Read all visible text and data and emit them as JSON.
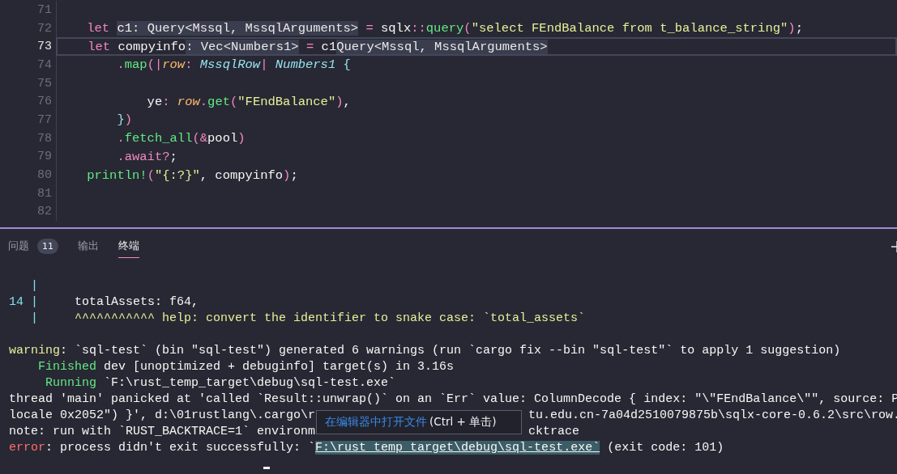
{
  "editor": {
    "lines": [
      {
        "number": "71",
        "current": false
      },
      {
        "number": "72",
        "current": false,
        "segments": [
          {
            "kind": "kw",
            "text": "    let "
          },
          {
            "kind": "sel",
            "text": "c1"
          },
          {
            "kind": "inlay",
            "text": ": Query<Mssql, MssqlArguments>"
          },
          {
            "kind": "punct",
            "text": " = "
          },
          {
            "kind": "plain",
            "text": "sqlx"
          },
          {
            "kind": "punct",
            "text": "::"
          },
          {
            "kind": "fn",
            "text": "query"
          },
          {
            "kind": "punct",
            "text": "("
          },
          {
            "kind": "str",
            "text": "\"select FEndBalance from t_balance_string\""
          },
          {
            "kind": "punct",
            "text": ")"
          },
          {
            "kind": "plain",
            "text": ";"
          }
        ]
      },
      {
        "number": "73",
        "current": true,
        "segments": [
          {
            "kind": "kw",
            "text": "    let "
          },
          {
            "kind": "plain",
            "text": "compyinfo"
          },
          {
            "kind": "inlay",
            "text": ": Vec<Numbers1>"
          },
          {
            "kind": "punct",
            "text": " = "
          },
          {
            "kind": "plain",
            "text": "c1"
          },
          {
            "kind": "inlay",
            "text": "Query<Mssql, MssqlArguments>"
          }
        ]
      },
      {
        "number": "74",
        "current": false,
        "segments": [
          {
            "kind": "punct",
            "text": "        ."
          },
          {
            "kind": "fn",
            "text": "map"
          },
          {
            "kind": "punct",
            "text": "(|"
          },
          {
            "kind": "param",
            "text": "row"
          },
          {
            "kind": "punct",
            "text": ":"
          },
          {
            "kind": "type",
            "text": " MssqlRow"
          },
          {
            "kind": "punct",
            "text": "|"
          },
          {
            "kind": "type",
            "text": " Numbers1"
          },
          {
            "kind": "brace",
            "text": " {"
          }
        ]
      },
      {
        "number": "75",
        "current": false
      },
      {
        "number": "76",
        "current": false,
        "segments": [
          {
            "kind": "plain",
            "text": "            ye"
          },
          {
            "kind": "punct",
            "text": ":"
          },
          {
            "kind": "param",
            "text": " row"
          },
          {
            "kind": "punct",
            "text": "."
          },
          {
            "kind": "fn",
            "text": "get"
          },
          {
            "kind": "punct",
            "text": "("
          },
          {
            "kind": "str",
            "text": "\"FEndBalance\""
          },
          {
            "kind": "punct",
            "text": ")"
          },
          {
            "kind": "plain",
            "text": ","
          }
        ]
      },
      {
        "number": "77",
        "current": false,
        "segments": [
          {
            "kind": "brace",
            "text": "        }"
          },
          {
            "kind": "punct",
            "text": ")"
          }
        ]
      },
      {
        "number": "78",
        "current": false,
        "segments": [
          {
            "kind": "punct",
            "text": "        ."
          },
          {
            "kind": "fn",
            "text": "fetch_all"
          },
          {
            "kind": "punct",
            "text": "(&"
          },
          {
            "kind": "plain",
            "text": "pool"
          },
          {
            "kind": "punct",
            "text": ")"
          }
        ]
      },
      {
        "number": "79",
        "current": false,
        "segments": [
          {
            "kind": "punct",
            "text": "        .await?"
          },
          {
            "kind": "plain",
            "text": ";"
          }
        ]
      },
      {
        "number": "80",
        "current": false,
        "segments": [
          {
            "kind": "fn",
            "text": "    println!"
          },
          {
            "kind": "punct",
            "text": "("
          },
          {
            "kind": "str",
            "text": "\"{:?}\""
          },
          {
            "kind": "plain",
            "text": ", compyinfo"
          },
          {
            "kind": "punct",
            "text": ")"
          },
          {
            "kind": "plain",
            "text": ";"
          }
        ]
      },
      {
        "number": "81",
        "current": false
      },
      {
        "number": "82",
        "current": false
      }
    ]
  },
  "panel": {
    "tabs": [
      {
        "label": "问题",
        "badge": "11",
        "selected": false
      },
      {
        "label": "输出",
        "selected": false
      },
      {
        "label": "终端",
        "selected": true
      }
    ],
    "terminal": {
      "lines": [
        {
          "kind": "output",
          "segments": [
            {
              "kind": "gutter",
              "text": "   |"
            }
          ]
        },
        {
          "kind": "output",
          "segments": [
            {
              "kind": "gutter",
              "text": "14 |"
            },
            {
              "kind": "plain",
              "text": "     totalAssets: f64,"
            }
          ]
        },
        {
          "kind": "output",
          "segments": [
            {
              "kind": "gutter",
              "text": "   |"
            },
            {
              "kind": "warn",
              "text": "     ^^^^^^^^^^^ help: convert the identifier to snake case: `total_assets`"
            }
          ]
        },
        {
          "kind": "blank"
        },
        {
          "kind": "output",
          "segments": [
            {
              "kind": "warn",
              "text": "warning"
            },
            {
              "kind": "plain",
              "text": ": `sql-test` (bin \"sql-test\") generated 6 warnings (run `cargo fix --bin \"sql-test\"` to apply 1 suggestion)"
            }
          ]
        },
        {
          "kind": "output",
          "segments": [
            {
              "kind": "ok",
              "text": "    Finished"
            },
            {
              "kind": "plain",
              "text": " dev [unoptimized + debuginfo] target(s) in 3.16s"
            }
          ]
        },
        {
          "kind": "output",
          "segments": [
            {
              "kind": "ok",
              "text": "     Running"
            },
            {
              "kind": "plain",
              "text": " `F:\\rust_temp_target\\debug\\sql-test.exe`"
            }
          ]
        },
        {
          "kind": "output",
          "segments": [
            {
              "kind": "plain",
              "text": "thread 'main' panicked at 'called `Result::unwrap()` on an `Err` value: ColumnDecode { index: \"\\\"FEndBalance\\\"\", source: P"
            }
          ]
        },
        {
          "kind": "output",
          "segments": [
            {
              "kind": "plain",
              "text": "locale 0x2052\") }', d:\\01rustlang\\.cargo\\r"
            }
          ],
          "after_tooltip": "tu.edu.cn-7a04d2510079875b\\sqlx-core-0.6.2\\src\\row."
        },
        {
          "kind": "output",
          "segments": [
            {
              "kind": "plain",
              "text": "note: run with `RUST_BACKTRACE=1` environm"
            }
          ],
          "after_tooltip": "cktrace"
        },
        {
          "kind": "output",
          "segments": [
            {
              "kind": "err",
              "text": "error"
            },
            {
              "kind": "plain",
              "text": ": process didn't exit successfully: `"
            },
            {
              "kind": "link",
              "text": "F:\\rust_temp_target\\debug\\sql-test.exe`"
            },
            {
              "kind": "plain",
              "text": " (exit code: 101)"
            }
          ]
        }
      ]
    },
    "tooltip": {
      "action": "在编辑器中打开文件",
      "shortcut": "(Ctrl + 单击)"
    }
  }
}
